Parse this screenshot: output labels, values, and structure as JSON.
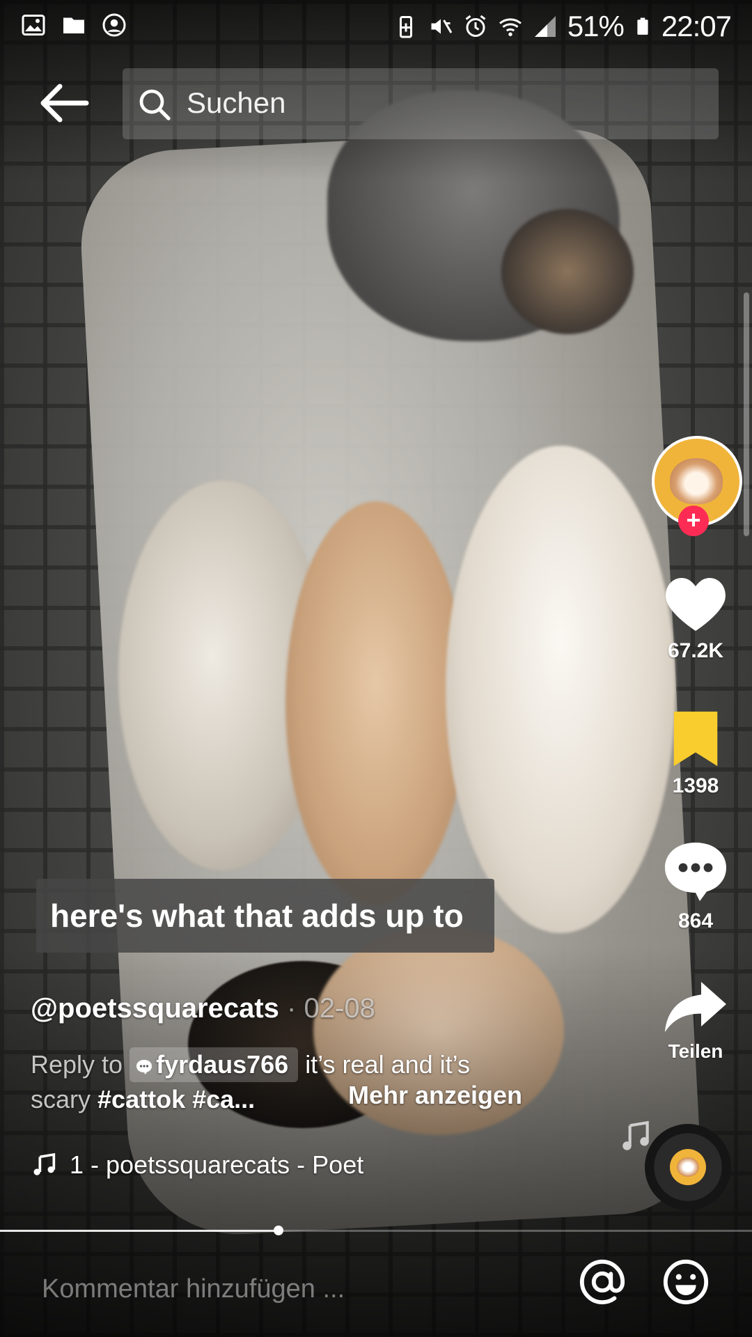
{
  "status_bar": {
    "time": "22:07",
    "battery": "51%",
    "left_icons": [
      "gallery-icon",
      "folder-icon",
      "account-icon"
    ],
    "right_icons": [
      "battery-saver-icon",
      "mute-icon",
      "alarm-icon",
      "wifi-icon",
      "signal-icon",
      "battery-icon"
    ]
  },
  "top_bar": {
    "back_icon": "arrow-left-icon",
    "search_label": "Suchen"
  },
  "overlay_caption": "here's what that adds up to",
  "post": {
    "username": "@poetssquarecats",
    "separator": "·",
    "date": "02-08",
    "reply_prefix": "Reply to",
    "reply_user": "fyrdaus766",
    "reply_text": "it’s real and it’s",
    "reply_text_2": "scary",
    "hashtags": "#cattok #ca...",
    "more_label": "Mehr anzeigen",
    "sound": "1 - poetssquarecats - Poet"
  },
  "actions": {
    "likes": "67.2K",
    "saves": "1398",
    "comments": "864",
    "share_label": "Teilen"
  },
  "progress": 0.37,
  "comment_bar": {
    "placeholder": "Kommentar hinzufügen ..."
  },
  "colors": {
    "follow_accent": "#fe2c55",
    "save_active": "#facd2e",
    "avatar_bg": "#f0b43a"
  }
}
